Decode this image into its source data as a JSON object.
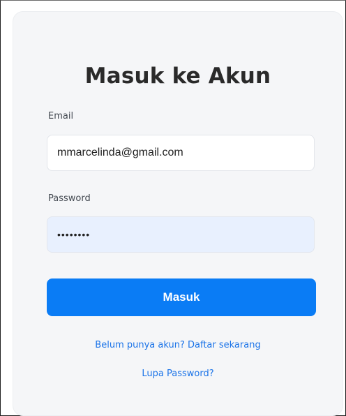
{
  "login": {
    "title": "Masuk ke Akun",
    "email_label": "Email",
    "email_value": "mmarcelinda@gmail.com",
    "password_label": "Password",
    "password_value": "********",
    "submit_label": "Masuk",
    "register_link": "Belum punya akun? Daftar sekarang",
    "forgot_link": "Lupa Password?"
  },
  "colors": {
    "primary": "#0a7cf5",
    "link": "#1a73e8",
    "card_bg": "#f5f6f8",
    "password_bg": "#e8f0fe"
  }
}
